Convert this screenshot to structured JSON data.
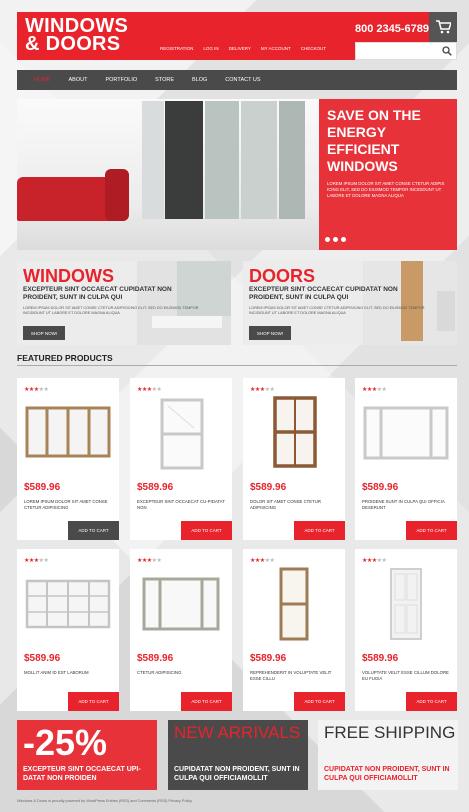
{
  "header": {
    "logo_line1": "WINDOWS",
    "logo_line2": "& DOORS",
    "phone": "800 2345-6789",
    "top_links": [
      "Registration",
      "Log in",
      "Delivery",
      "My account",
      "Checkout"
    ],
    "accent": "#e8232b",
    "dark": "#4a4a4a"
  },
  "nav": {
    "items": [
      "Home",
      "About",
      "Portfolio",
      "Store",
      "Blog",
      "Contact us"
    ],
    "active": "Home"
  },
  "slider": {
    "title": "SAVE ON THE ENERGY EFFICIENT WINDOWS",
    "text": "LOREM IPSUM DOLOR SIT AMET CONSE CTETUR ADIPIS ICING ELIT, SED DO EIUSMOD TEMPOR INCIDIDUNT UT LABORE ET DOLORE MAGNA ALIQUA"
  },
  "banners": [
    {
      "title": "WINDOWS",
      "subtitle": "EXCEPTEUR SINT OCCAECAT CUPIDATAT NON PROIDENT, SUNT IN CULPA QUI",
      "text": "LOREM IPSUM DOLOR SIT AMET CONSE CTETUR ADIPISICING ELIT, SED DO EIUSMOD TEMPOR INCIDIDUNT UT LABORE ET DOLORE MAGNA ALIQUA",
      "button": "SHOP NOW!"
    },
    {
      "title": "DOORS",
      "subtitle": "EXCEPTEUR SINT OCCAECAT CUPIDATAT NON PROIDENT, SUNT IN CULPA QUI",
      "text": "LOREM IPSUM DOLOR SIT AMET CONSE CTETUR ADIPISICING ELIT, SED DO EIUSMOD TEMPOR INCIDIDUNT UT LABORE ET DOLORE MAGNA ALIQUA",
      "button": "SHOP NOW!"
    }
  ],
  "featured": {
    "title": "FEATURED PRODUCTS",
    "products": [
      {
        "price": "$589.96",
        "desc": "LOREM IPSUM DOLOR SIT AMET CONSE CTETUR ADIPISICING",
        "button": "ADD TO CART",
        "rating": 3,
        "icon": "bay-window-icon"
      },
      {
        "price": "$589.96",
        "desc": "EXCEPTEUR SINT OCCAECAT CU-PIDATAT NON",
        "button": "ADD TO CART",
        "rating": 3,
        "icon": "sash-window-icon"
      },
      {
        "price": "$589.96",
        "desc": "DOLOR SIT AMET CONSE CTETUR ADIPISICING",
        "button": "ADD TO CART",
        "rating": 3,
        "icon": "wood-sash-window-icon"
      },
      {
        "price": "$589.96",
        "desc": "PROIDENE SUNT IN CULPA QUI OFFICIA DESERUNT",
        "button": "ADD TO CART",
        "rating": 3,
        "icon": "white-bay-window-icon"
      },
      {
        "price": "$589.96",
        "desc": "MOLLIT ANIM ID EST LABORUM",
        "button": "ADD TO CART",
        "rating": 3,
        "icon": "grid-window-icon"
      },
      {
        "price": "$589.96",
        "desc": "CTETUR ADIPISICING",
        "button": "ADD TO CART",
        "rating": 3,
        "icon": "angled-bay-window-icon"
      },
      {
        "price": "$589.96",
        "desc": "REPREHENDERIT IN VOLUPTATE VELIT ESSE CILLU",
        "button": "ADD TO CART",
        "rating": 3,
        "icon": "door-frame-icon"
      },
      {
        "price": "$589.96",
        "desc": "VOLUPTATE VELIT ESSE CILLUM DOLORE EU FUGIA",
        "button": "ADD TO CART",
        "rating": 3,
        "icon": "white-door-icon"
      }
    ]
  },
  "bottom_promos": [
    {
      "big": "-25%",
      "sub": "EXCEPTEUR SINT OCCAECAT UPI-DATAT NON PROIDEN"
    },
    {
      "title": "NEW ARRIVALS",
      "sub": "CUPIDATAT NON PROIDENT, SUNT IN CULPA QUI OFFICIAMOLLIT"
    },
    {
      "title": "FREE SHIPPING",
      "sub": "CUPIDATAT NON PROIDENT, SUNT IN CULPA QUI OFFICIAMOLLIT"
    }
  ],
  "footer": {
    "text": "Windows & Doors is proudly powered by WordPress Entries (RSS) and Comments (RSS) Privacy Policy"
  }
}
